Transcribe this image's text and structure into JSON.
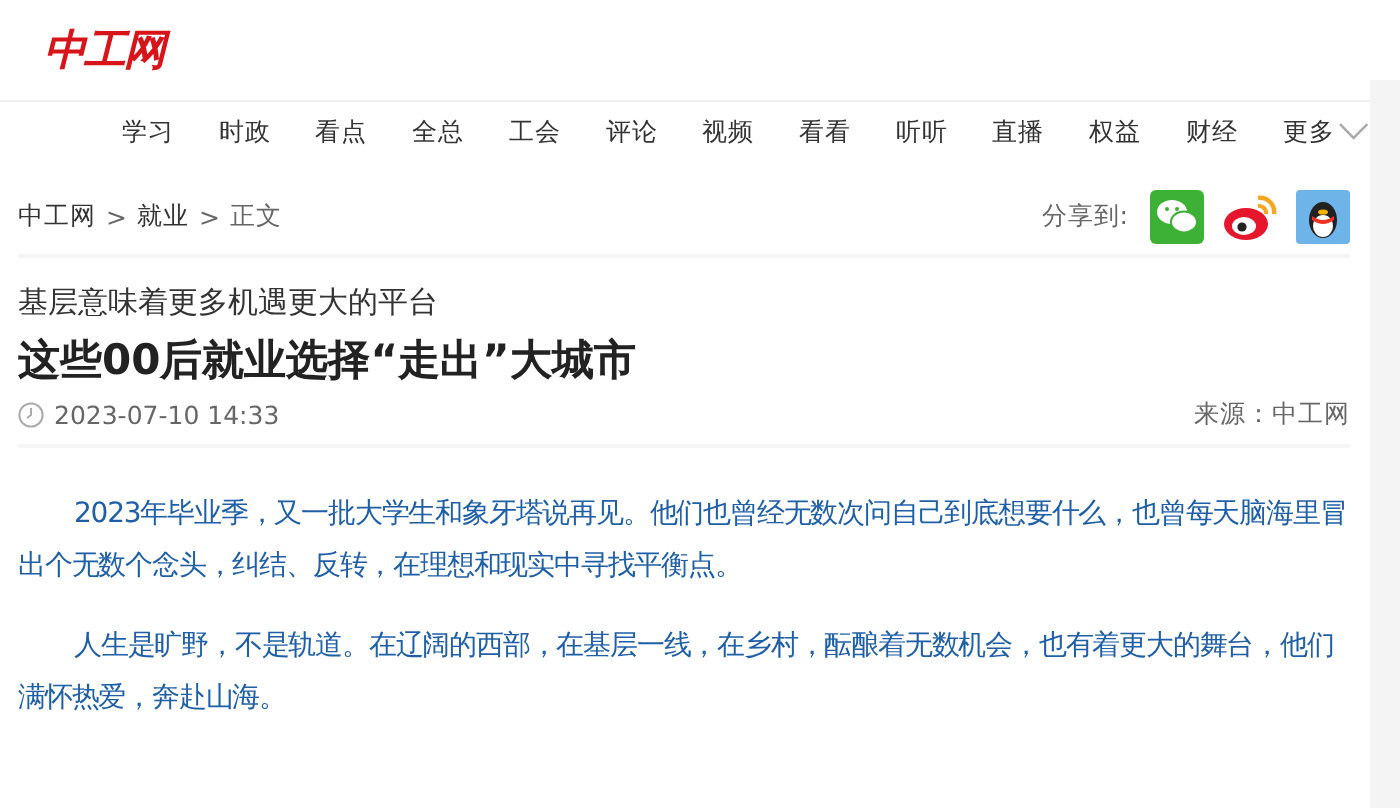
{
  "logo": "中工网",
  "nav": {
    "items": [
      "学习",
      "时政",
      "看点",
      "全总",
      "工会",
      "评论",
      "视频",
      "看看",
      "听听",
      "直播",
      "权益",
      "财经"
    ],
    "more": "更多"
  },
  "breadcrumb": {
    "separator": ">",
    "items": [
      "中工网",
      "就业",
      "正文"
    ]
  },
  "share": {
    "label": "分享到:",
    "targets": [
      {
        "kind": "wechat"
      },
      {
        "kind": "weibo"
      },
      {
        "kind": "qq"
      }
    ]
  },
  "article": {
    "subtitle": "基层意味着更多机遇更大的平台",
    "title": "这些00后就业选择“走出”大城市",
    "time": "2023-07-10 14:33",
    "source": "来源：中工网",
    "paragraphs": [
      "2023年毕业季，又一批大学生和象牙塔说再见。他们也曾经无数次问自己到底想要什么，也曾每天脑海里冒出个无数个念头，纠结、反转，在理想和现实中寻找平衡点。",
      "人生是旷野，不是轨道。在辽阔的西部，在基层一线，在乡村，酝酿着无数机会，也有着更大的舞台，他们满怀热爱，奔赴山海。"
    ]
  }
}
